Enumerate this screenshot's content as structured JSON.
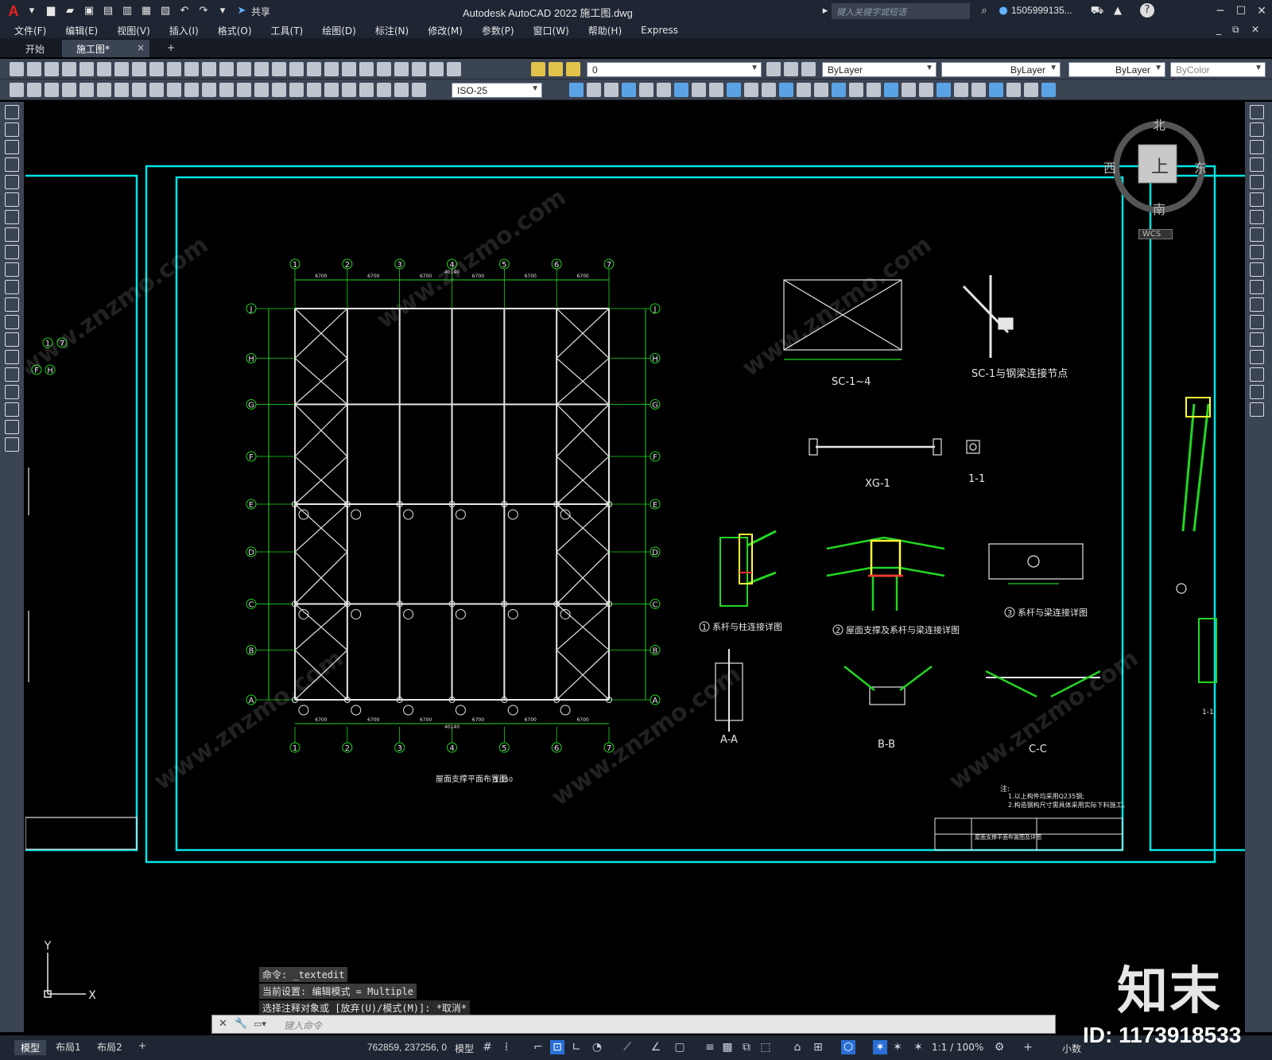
{
  "app": {
    "logo": "A",
    "title": "Autodesk AutoCAD 2022    施工图.dwg",
    "share_label": "共享",
    "search_placeholder": "键入关键字或短语",
    "user": "1505999135...",
    "help": "?"
  },
  "menu": [
    "文件(F)",
    "编辑(E)",
    "视图(V)",
    "插入(I)",
    "格式(O)",
    "工具(T)",
    "绘图(D)",
    "标注(N)",
    "修改(M)",
    "参数(P)",
    "窗口(W)",
    "帮助(H)",
    "Express"
  ],
  "tabs": {
    "start": "开始",
    "drawing": "施工图*",
    "close": "×",
    "add": "+"
  },
  "toolbar": {
    "layer": "0",
    "color": "ByLayer",
    "linetype": "ByLayer",
    "lineweight": "ByLayer",
    "plotstyle": "ByColor",
    "dimstyle": "ISO-25"
  },
  "viewcube": {
    "north": "北",
    "south": "南",
    "east": "东",
    "west": "西",
    "top": "上",
    "wcs": "WCS"
  },
  "drawing": {
    "axis_numbers": [
      "1",
      "2",
      "3",
      "4",
      "5",
      "6",
      "7"
    ],
    "axis_letters": [
      "J",
      "H",
      "G",
      "F",
      "E",
      "D",
      "C",
      "B",
      "A"
    ],
    "span": "6700",
    "total_width": "40140",
    "left_markers": [
      "1",
      "7",
      "F",
      "H"
    ],
    "plan_title": "屋面支撑平面布置图",
    "plan_scale": "1:150",
    "labels": {
      "sc14": "SC-1~4",
      "sc1_node": "SC-1与钢梁连接节点",
      "xg1": "XG-1",
      "i1": "1-1",
      "aa": "A-A",
      "bb": "B-B",
      "cc": "C-C",
      "detail1": "系杆与柱连接详图",
      "detail2": "屋面支撑及系杆与梁连接详图",
      "detail3": "系杆与梁连接详图",
      "detail1_num": "1",
      "detail2_num": "2",
      "detail3_num": "3",
      "note_title": "注:",
      "note1": "1.以上构件均采用Q235钢;",
      "note2": "2.构造钢构尺寸需具体采用实际下料施工。",
      "titleblock": "屋面支撑平面布置图及详图",
      "right_i1": "1-1"
    }
  },
  "command": {
    "history": [
      "命令: _textedit",
      "当前设置: 编辑模式 = Multiple",
      "选择注释对象或 [放弃(U)/模式(M)]: *取消*"
    ],
    "input_placeholder": "键入命令"
  },
  "ucs": {
    "x": "X",
    "y": "Y"
  },
  "status": {
    "model_tab": "模型",
    "layout1": "布局1",
    "layout2": "布局2",
    "add": "+",
    "coords": "762859, 237256, 0",
    "model": "模型",
    "scale": "1:1 / 100%",
    "units": "小数"
  },
  "watermark": {
    "brand": "知末",
    "id": "ID: 1173918533",
    "site": "www.znzmo.com"
  },
  "colors": {
    "frame": "#00e5e5",
    "axis": "#22d622",
    "member": "#e6e6e6",
    "label": "#ffff33",
    "accent": "#22d622"
  }
}
